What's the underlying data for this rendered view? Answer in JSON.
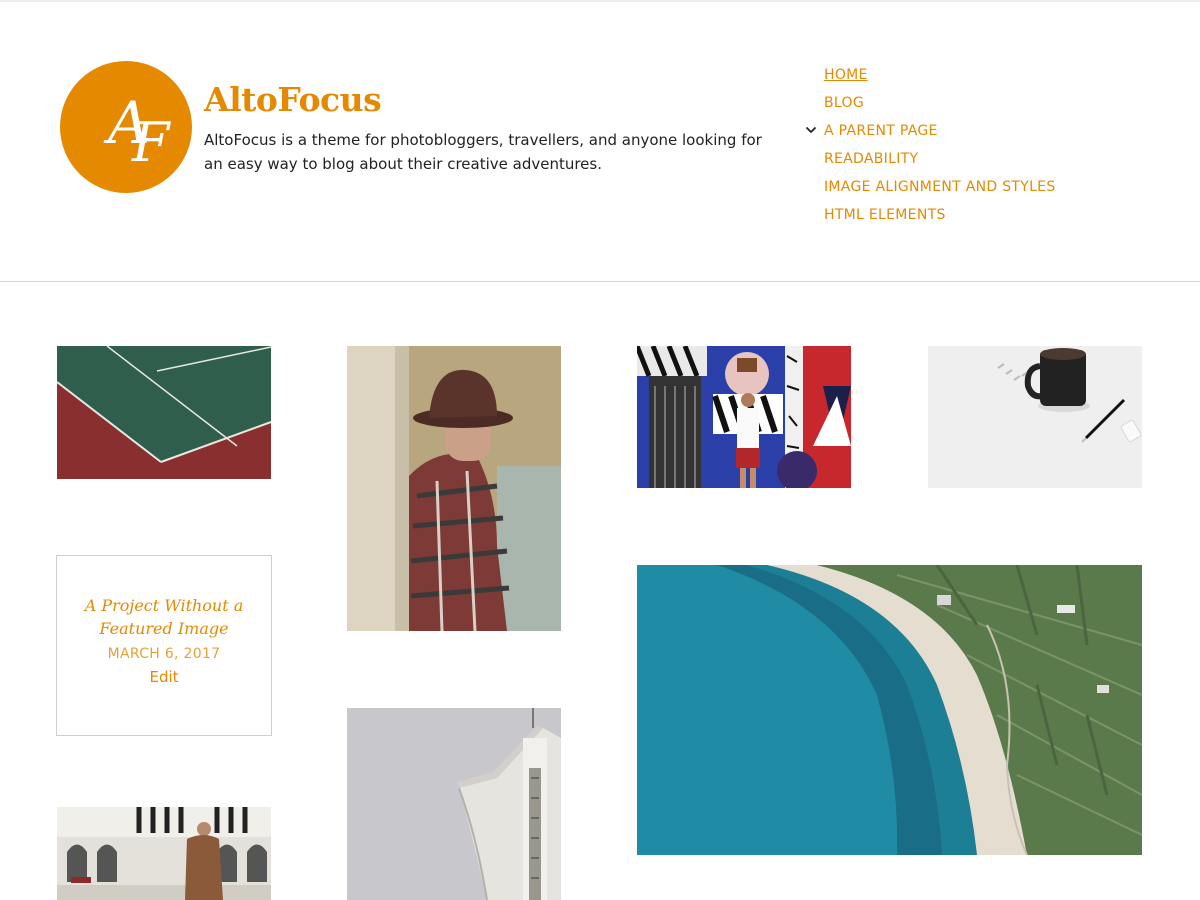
{
  "site": {
    "logo_text": "AF",
    "title": "AltoFocus",
    "description": "AltoFocus is a theme for photobloggers, travellers, and anyone looking for an easy way to blog about their creative adventures."
  },
  "nav": {
    "items": [
      {
        "label": "HOME"
      },
      {
        "label": "BLOG"
      },
      {
        "label": "A PARENT PAGE"
      },
      {
        "label": "READABILITY"
      },
      {
        "label": "IMAGE ALIGNMENT AND STYLES"
      },
      {
        "label": "HTML ELEMENTS"
      }
    ]
  },
  "card": {
    "title": "A Project Without a Featured Image",
    "date": "MARCH 6, 2017",
    "edit_label": "Edit"
  },
  "colors": {
    "accent": "#e58a00",
    "date": "#e5a13a"
  }
}
